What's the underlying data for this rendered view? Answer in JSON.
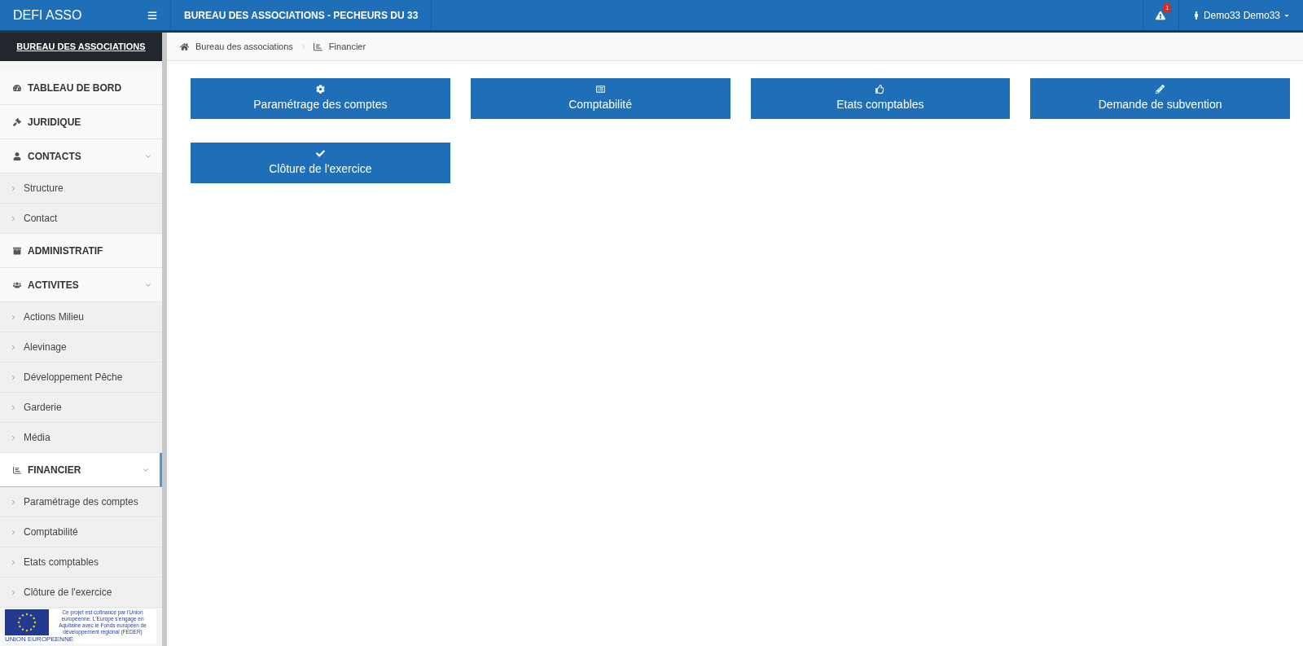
{
  "topbar": {
    "brand": "DEFI ASSO",
    "title": "BUREAU DES ASSOCIATIONS - PECHEURS DU 33",
    "alert_count": "1",
    "user": "Demo33 Demo33"
  },
  "sidebar": {
    "heading": "BUREAU DES ASSOCIATIONS",
    "items": [
      {
        "label": "TABLEAU DE BORD",
        "selected": false
      },
      {
        "label": "JURIDIQUE",
        "selected": false
      },
      {
        "label": "CONTACTS",
        "selected": false,
        "expanded": true,
        "children": [
          {
            "label": "Structure"
          },
          {
            "label": "Contact"
          }
        ]
      },
      {
        "label": "ADMINISTRATIF",
        "selected": false
      },
      {
        "label": "ACTIVITES",
        "selected": false,
        "expanded": true,
        "children": [
          {
            "label": "Actions Milieu"
          },
          {
            "label": "Alevinage"
          },
          {
            "label": "Développement Pêche"
          },
          {
            "label": "Garderie"
          },
          {
            "label": "Média"
          }
        ]
      },
      {
        "label": "FINANCIER",
        "selected": true,
        "expanded": true,
        "children": [
          {
            "label": "Paramétrage des comptes"
          },
          {
            "label": "Comptabilité"
          },
          {
            "label": "Etats comptables"
          },
          {
            "label": "Clôture de l'exercice"
          }
        ]
      }
    ],
    "banner": {
      "caption": "UNION EUROPEENNE",
      "text": "Ce projet est cofinancé par l'Union européenne. L'Europe s'engage en Aquitaine avec le Fonds européen de développement régional (FEDER)"
    }
  },
  "breadcrumb": [
    {
      "label": "Bureau des associations"
    },
    {
      "label": "Financier"
    }
  ],
  "tiles": [
    {
      "label": "Paramétrage des comptes"
    },
    {
      "label": "Comptabilité"
    },
    {
      "label": "Etats comptables"
    },
    {
      "label": "Demande de subvention"
    },
    {
      "label": "Clôture de l'exercice"
    }
  ]
}
